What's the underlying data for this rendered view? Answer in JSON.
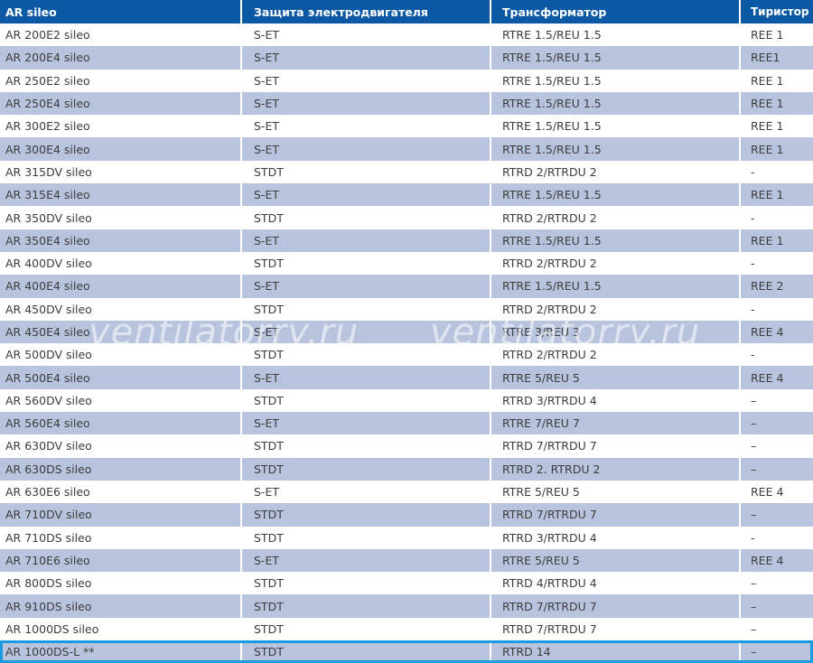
{
  "table": {
    "headers": [
      "AR sileo",
      "Защита электродвигателя",
      "Трансформатор",
      "Тиристор"
    ],
    "rows": [
      [
        "AR 200E2 sileo",
        "S-ET",
        "RTRE 1.5/REU 1.5",
        "REE 1"
      ],
      [
        "AR 200E4 sileo",
        "S-ET",
        "RTRE 1.5/REU 1.5",
        "REE1"
      ],
      [
        "AR 250E2 sileo",
        "S-ET",
        "RTRE 1.5/REU 1.5",
        "REE 1"
      ],
      [
        "AR 250E4 sileo",
        "S-ET",
        "RTRE 1.5/REU 1.5",
        "REE 1"
      ],
      [
        "AR 300E2 sileo",
        "S-ET",
        "RTRE 1.5/REU 1.5",
        "REE 1"
      ],
      [
        "AR 300E4 sileo",
        "S-ET",
        "RTRE 1.5/REU 1.5",
        "REE 1"
      ],
      [
        "AR 315DV sileo",
        "STDT",
        "RTRD 2/RTRDU 2",
        "-"
      ],
      [
        "AR 315E4 sileo",
        "S-ET",
        "RTRE 1.5/REU 1.5",
        "REE 1"
      ],
      [
        "AR 350DV sileo",
        "STDT",
        "RTRD 2/RTRDU 2",
        "-"
      ],
      [
        "AR 350E4 sileo",
        "S-ET",
        "RTRE 1.5/REU 1.5",
        "REE 1"
      ],
      [
        "AR 400DV sileo",
        "STDT",
        "RTRD 2/RTRDU 2",
        "-"
      ],
      [
        "AR 400E4 sileo",
        "S-ET",
        "RTRE 1.5/REU 1.5",
        "REE 2"
      ],
      [
        "AR 450DV sileo",
        "STDT",
        "RTRD 2/RTRDU 2",
        "-"
      ],
      [
        "AR 450E4 sileo",
        "S-ET",
        "RTRE 3/REU 3",
        "REE 4"
      ],
      [
        "AR 500DV sileo",
        "STDT",
        "RTRD 2/RTRDU 2",
        "-"
      ],
      [
        "AR 500E4 sileo",
        "S-ET",
        "RTRE 5/REU 5",
        "REE 4"
      ],
      [
        "AR 560DV sileo",
        "STDT",
        "RTRD 3/RTRDU 4",
        "–"
      ],
      [
        "AR 560E4 sileo",
        "S-ET",
        "RTRE 7/REU 7",
        "–"
      ],
      [
        "AR 630DV sileo",
        "STDT",
        "RTRD 7/RTRDU 7",
        "–"
      ],
      [
        "AR 630DS sileo",
        "STDT",
        "RTRD 2. RTRDU 2",
        "–"
      ],
      [
        "AR 630E6 sileo",
        "S-ET",
        "RTRE 5/REU 5",
        "REE 4"
      ],
      [
        "AR 710DV sileo",
        "STDT",
        "RTRD 7/RTRDU 7",
        "–"
      ],
      [
        "AR 710DS sileo",
        "STDT",
        "RTRD 3/RTRDU 4",
        "-"
      ],
      [
        "AR 710E6 sileo",
        "S-ET",
        "RTRE 5/REU 5",
        "REE 4"
      ],
      [
        "AR 800DS sileo",
        "STDT",
        "RTRD 4/RTRDU 4",
        "–"
      ],
      [
        "AR 910DS sileo",
        "STDT",
        "RTRD 7/RTRDU 7",
        "–"
      ],
      [
        "AR 1000DS sileo",
        "STDT",
        "RTRD 7/RTRDU 7",
        "–"
      ],
      [
        "AR 1000DS-L **",
        "STDT",
        "RTRD 14",
        "–"
      ]
    ]
  },
  "watermark": {
    "text_left": "ventilatorry.ru",
    "text_right": "ventilatorry.ru"
  },
  "colors": {
    "header_bg": "#0b58a4",
    "stripe_bg": "#b8c4de",
    "highlight_outline": "#1a9ae0"
  }
}
